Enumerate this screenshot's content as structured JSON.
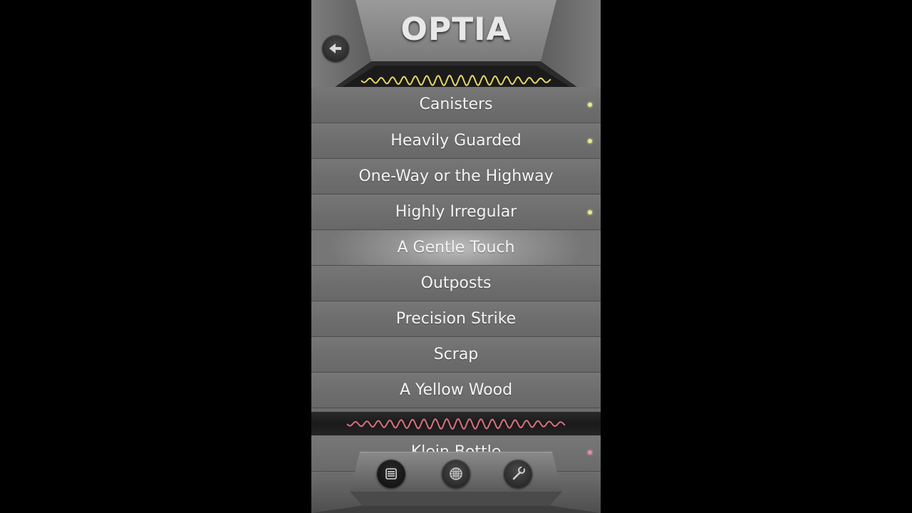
{
  "header": {
    "title": "OPTIA",
    "back_icon": "back-arrow-icon",
    "wave_color": "#e3d96a"
  },
  "levels": [
    {
      "label": "Canisters",
      "completed": true
    },
    {
      "label": "Heavily Guarded",
      "completed": true
    },
    {
      "label": "One-Way or the Highway",
      "completed": false
    },
    {
      "label": "Highly Irregular",
      "completed": true
    },
    {
      "label": "A Gentle Touch",
      "completed": false,
      "selected": true
    },
    {
      "label": "Outposts",
      "completed": false
    },
    {
      "label": "Precision Strike",
      "completed": false
    },
    {
      "label": "Scrap",
      "completed": false
    },
    {
      "label": "A Yellow Wood",
      "completed": false
    }
  ],
  "next_section": {
    "wave_color": "#d9707e",
    "first_level": {
      "label": "Klein Bottle",
      "completed": true
    }
  },
  "toolbar": {
    "buttons": [
      {
        "icon": "level-list-icon",
        "active": true
      },
      {
        "icon": "grid-icon",
        "active": false
      },
      {
        "icon": "wrench-icon",
        "active": false
      }
    ]
  },
  "colors": {
    "completed_dot": "#e8ea8f",
    "next_section_dot": "#e88aa0"
  }
}
